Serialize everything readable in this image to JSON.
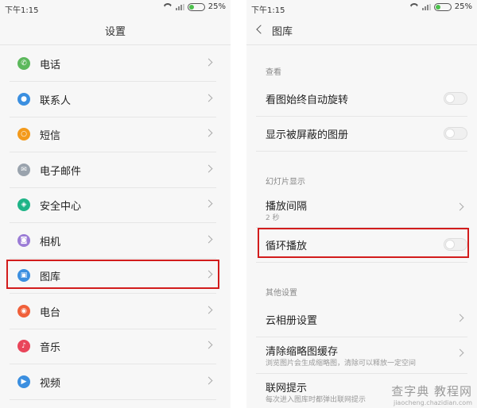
{
  "left": {
    "status": {
      "time": "下午1:15",
      "battery": "25%"
    },
    "title": "设置",
    "items": [
      {
        "label": "电话",
        "icon": "phone-icon",
        "color": "#5cb85c",
        "glyph": "✆"
      },
      {
        "label": "联系人",
        "icon": "contacts-icon",
        "color": "#3b8fe0",
        "glyph": "●"
      },
      {
        "label": "短信",
        "icon": "message-icon",
        "color": "#f39a1c",
        "glyph": "○"
      },
      {
        "label": "电子邮件",
        "icon": "mail-icon",
        "color": "#9aa3ad",
        "glyph": "✉"
      },
      {
        "label": "安全中心",
        "icon": "shield-icon",
        "color": "#1fb487",
        "glyph": "◈"
      },
      {
        "label": "相机",
        "icon": "camera-icon",
        "color": "#9b7cd6",
        "glyph": "◙"
      },
      {
        "label": "图库",
        "icon": "gallery-icon",
        "color": "#3b8fe0",
        "glyph": "▣"
      },
      {
        "label": "电台",
        "icon": "radio-icon",
        "color": "#f0603a",
        "glyph": "◉"
      },
      {
        "label": "音乐",
        "icon": "music-icon",
        "color": "#e9455a",
        "glyph": "♪"
      },
      {
        "label": "视频",
        "icon": "video-icon",
        "color": "#3b8fe0",
        "glyph": "▶"
      }
    ]
  },
  "right": {
    "status": {
      "time": "下午1:15",
      "battery": "25%"
    },
    "title": "图库",
    "section_view": "查看",
    "auto_rotate": "看图始终自动旋转",
    "show_hidden": "显示被屏蔽的图册",
    "section_slideshow": "幻灯片显示",
    "interval_label": "播放间隔",
    "interval_value": "2 秒",
    "loop_label": "循环播放",
    "section_other": "其他设置",
    "cloud_label": "云相册设置",
    "clear_cache_label": "清除缩略图缓存",
    "clear_cache_desc": "浏览图片会生成缩略图，清除可以释放一定空间",
    "network_label": "联网提示",
    "network_desc": "每次进入图库时都弹出联网提示"
  },
  "watermark": {
    "main": "查字典 教程网",
    "url": "jiaocheng.chazidian.com"
  }
}
